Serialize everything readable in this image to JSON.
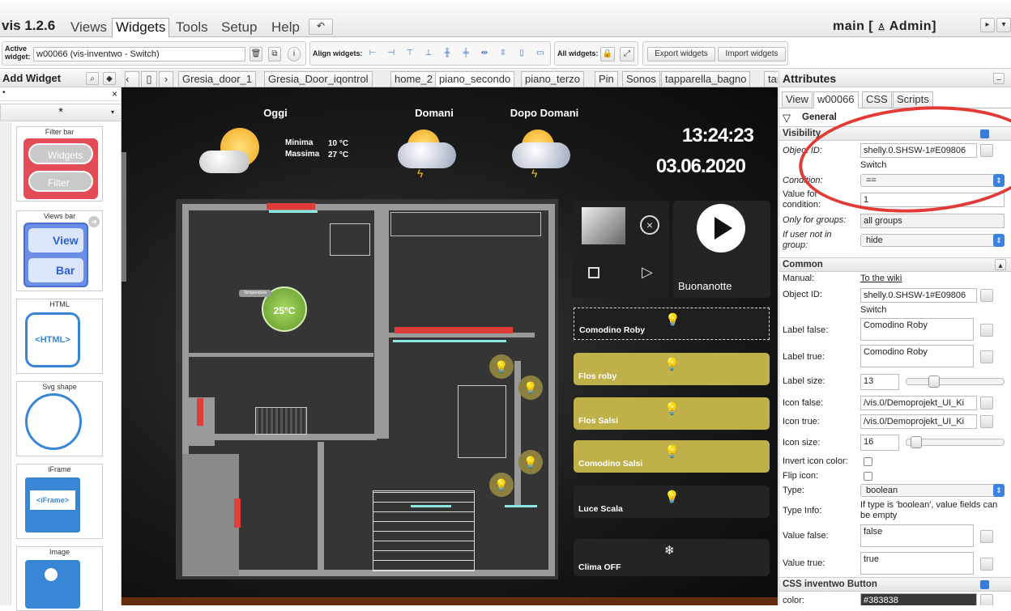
{
  "app": {
    "name": "vis 1.2.6",
    "main_label": "main [ ",
    "user": "Admin]"
  },
  "menu": [
    "Views",
    "Widgets",
    "Tools",
    "Setup",
    "Help"
  ],
  "toolbar": {
    "active_widget_label": "Active widget:",
    "active_widget_value": "w00066 (vis-inventwo - Switch)",
    "align_label": "Align widgets:",
    "all_widgets_label": "All widgets:",
    "export_label": "Export widgets",
    "import_label": "Import widgets"
  },
  "left_panel": {
    "title": "Add Widget",
    "filter_value": "*",
    "widgets": [
      {
        "title": "Filter bar",
        "b1": "Widgets",
        "b2": "Filter"
      },
      {
        "title": "Views bar",
        "b1": "View",
        "b2": "Bar"
      },
      {
        "title": "HTML",
        "label": "<HTML>"
      },
      {
        "title": "Svg shape"
      },
      {
        "title": "iFrame",
        "label": "<iFrame>"
      },
      {
        "title": "Image"
      }
    ]
  },
  "view_tabs": [
    "Gresia_door_1",
    "Gresia_Door_iqontrol",
    "home_2",
    "piano_secondo",
    "piano_terzo",
    "Pin",
    "Sonos",
    "tapparella_bagno",
    "tapparella"
  ],
  "active_view": "piano_secondo",
  "canvas": {
    "weather": [
      {
        "day": "Oggi"
      },
      {
        "day": "Domani"
      },
      {
        "day": "Dopo Domani"
      }
    ],
    "min_label": "Minima",
    "max_label": "Massima",
    "min_value": "10 °C",
    "max_value": "27 °C",
    "time": "13:24:23",
    "date": "03.06.2020",
    "thermo": "25°C",
    "thermo_tag": "Temperatura",
    "scene_label": "Buonanotte",
    "buttons": [
      {
        "label": "Comodino Roby",
        "state": "selected"
      },
      {
        "label": "Flos roby",
        "state": "on"
      },
      {
        "label": "Flos Salsi",
        "state": "on"
      },
      {
        "label": "Comodino Salsi",
        "state": "on"
      },
      {
        "label": "Luce Scala",
        "state": "off"
      },
      {
        "label": "Clima OFF",
        "state": "off"
      }
    ],
    "colors": {
      "on": "#bfb04a",
      "off": "#242424",
      "accent_red": "#e03c3c",
      "door_cyan": "#8ee8e0"
    }
  },
  "right_panel": {
    "title": "Attributes",
    "tabs": [
      "View",
      "w00066",
      "CSS",
      "Scripts"
    ],
    "general": "General",
    "visibility": "Visibility",
    "vis_rows": [
      {
        "label": "Object ID:",
        "value": "shelly.0.SHSW-1#E09806",
        "sub": "Switch"
      },
      {
        "label": "Condition:",
        "value": "=="
      },
      {
        "label": "Value for condition:",
        "value": "1"
      },
      {
        "label": "Only for groups:",
        "value": "all groups"
      },
      {
        "label": "If user not in group:",
        "value": "hide"
      }
    ],
    "common": "Common",
    "manual_label": "Manual:",
    "manual_link": "To the wiki",
    "common_rows": [
      {
        "label": "Object ID:",
        "value": "shelly.0.SHSW-1#E09806",
        "sub": "Switch"
      },
      {
        "label": "Label false:",
        "value": "Comodino Roby"
      },
      {
        "label": "Label true:",
        "value": "Comodino Roby"
      },
      {
        "label": "Label size:",
        "value": "13"
      },
      {
        "label": "Icon false:",
        "value": "/vis.0/Demoprojekt_UI_Ki"
      },
      {
        "label": "Icon true:",
        "value": "/vis.0/Demoprojekt_UI_Ki"
      },
      {
        "label": "Icon size:",
        "value": "16"
      },
      {
        "label": "Invert icon color:"
      },
      {
        "label": "Flip icon:"
      },
      {
        "label": "Type:",
        "value": "boolean"
      },
      {
        "label": "Type Info:",
        "value": "If type is 'boolean', value fields can be empty"
      },
      {
        "label": "Value false:",
        "value": "false"
      },
      {
        "label": "Value true:",
        "value": "true"
      }
    ],
    "css_section": "CSS inventwo Button",
    "color_label": "color:",
    "color_value": "#383838",
    "label_size_level": 0.25,
    "icon_size_level": 0.05
  }
}
